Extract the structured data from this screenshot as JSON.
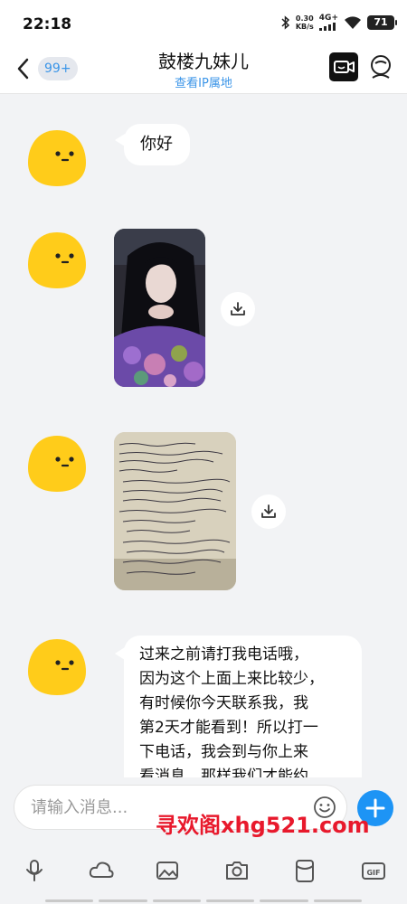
{
  "status_bar": {
    "time": "22:18",
    "net_speed_value": "0.30",
    "net_speed_unit": "KB/s",
    "network_type": "4G+",
    "battery": "71"
  },
  "header": {
    "unread_count": "99+",
    "title": "鼓楼九妹儿",
    "subtitle": "查看IP属地"
  },
  "messages": [
    {
      "type": "text",
      "text": "你好"
    },
    {
      "type": "image",
      "content": "photo of a woman with long dark hair in a floral top"
    },
    {
      "type": "image",
      "content": "photo of a handwritten note on paper"
    },
    {
      "type": "text",
      "lines": [
        "过来之前请打我电话哦，",
        "因为这个上面上来比较少，",
        "有时候你今天联系我，我",
        "第2天才能看到！所以打一",
        "下电话，我会到与你上来",
        "看消息，那样我们才能约"
      ]
    }
  ],
  "input": {
    "placeholder": "请输入消息..."
  },
  "toolbar": [
    "microphone-icon",
    "cloud-icon",
    "image-icon",
    "camera-icon",
    "red-packet-icon",
    "gif-icon"
  ],
  "watermark": "寻欢阁xhg521.com",
  "colors": {
    "accent": "#1d94f5",
    "link": "#3b95e8",
    "avatar": "#ffcc1a",
    "watermark": "#e8192c"
  }
}
